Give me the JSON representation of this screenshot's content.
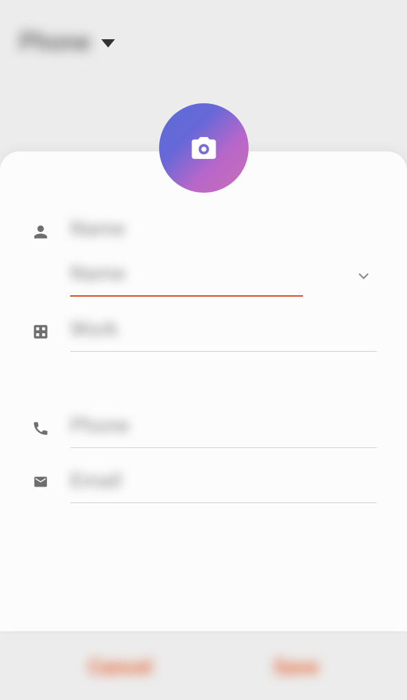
{
  "header": {
    "source_label": "Phone"
  },
  "avatar": {
    "icon_name": "camera-icon"
  },
  "fields": {
    "name_label": "Name",
    "name_placeholder": "Name",
    "work_placeholder": "Work",
    "phone_placeholder": "Phone",
    "email_placeholder": "Email"
  },
  "buttons": {
    "cancel": "Cancel",
    "save": "Save"
  },
  "colors": {
    "accent": "#e35a2a",
    "avatar_gradient_start": "#5a6dd8",
    "avatar_gradient_end": "#c76fb8"
  }
}
